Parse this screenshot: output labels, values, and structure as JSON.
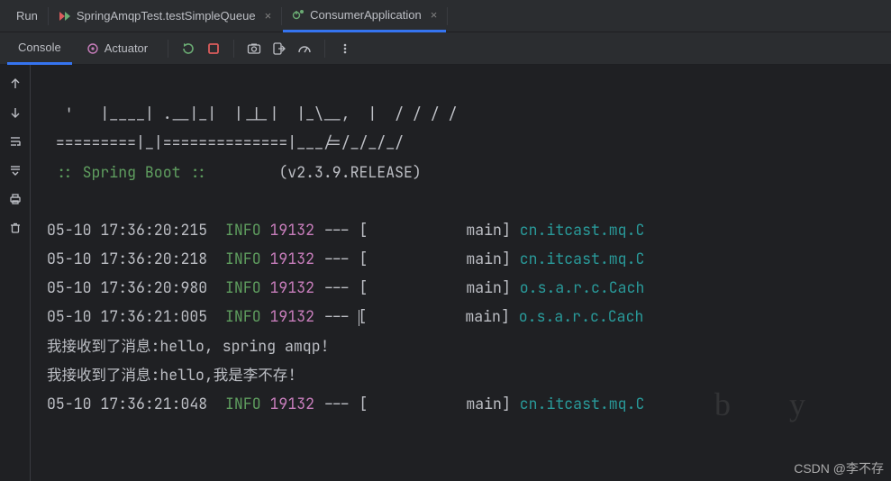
{
  "header": {
    "run_label": "Run",
    "tabs": [
      {
        "label": "SpringAmqpTest.testSimpleQueue",
        "active": false
      },
      {
        "label": "ConsumerApplication",
        "active": true
      }
    ]
  },
  "toolbar": {
    "console_label": "Console",
    "actuator_label": "Actuator"
  },
  "banner": {
    "line1": "  '   |____| .__|_|  |_|_|  |_\\__,  |  / / / /",
    "line2": " =========|_|==============|___/=/_/_/_/",
    "line3_prefix": " :: Spring Boot ::",
    "line3_spaces": "        ",
    "line3_version": "(v2.3.9.RELEASE)"
  },
  "logs": [
    {
      "ts": "05-10 17:36:20:215",
      "level": "INFO",
      "pid": "19132",
      "thread": "main",
      "logger": "cn.itcast.mq.C"
    },
    {
      "ts": "05-10 17:36:20:218",
      "level": "INFO",
      "pid": "19132",
      "thread": "main",
      "logger": "cn.itcast.mq.C"
    },
    {
      "ts": "05-10 17:36:20:980",
      "level": "INFO",
      "pid": "19132",
      "thread": "main",
      "logger": "o.s.a.r.c.Cach"
    },
    {
      "ts": "05-10 17:36:21:005",
      "level": "INFO",
      "pid": "19132",
      "thread": "main",
      "logger": "o.s.a.r.c.Cach"
    }
  ],
  "messages": [
    "我接收到了消息:hello, spring amqp!",
    "我接收到了消息:hello,我是李不存!"
  ],
  "tail_log": {
    "ts": "05-10 17:36:21:048",
    "level": "INFO",
    "pid": "19132",
    "thread": "main",
    "logger": "cn.itcast.mq.C"
  },
  "watermark": "CSDN @李不存",
  "big_watermark": "b y "
}
